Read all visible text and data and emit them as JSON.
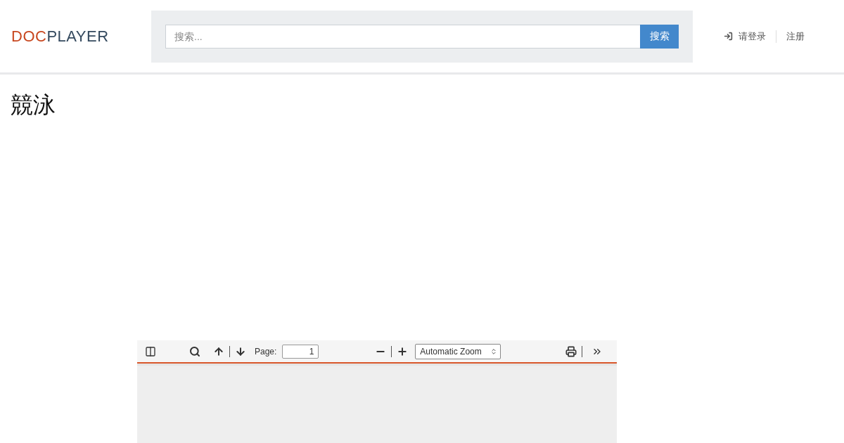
{
  "header": {
    "logo": {
      "part_1": "DOC",
      "part_2": "PLAYER"
    },
    "search": {
      "placeholder": "搜索...",
      "button": "搜索"
    },
    "nav": [
      {
        "label": "请登录",
        "kind": "login"
      },
      {
        "label": "注册",
        "kind": "plain"
      }
    ]
  },
  "title": "競泳",
  "viewer": {
    "toolbar": {
      "page_label": "Page:",
      "page_value": "1",
      "zoom": "Automatic Zoom"
    }
  }
}
